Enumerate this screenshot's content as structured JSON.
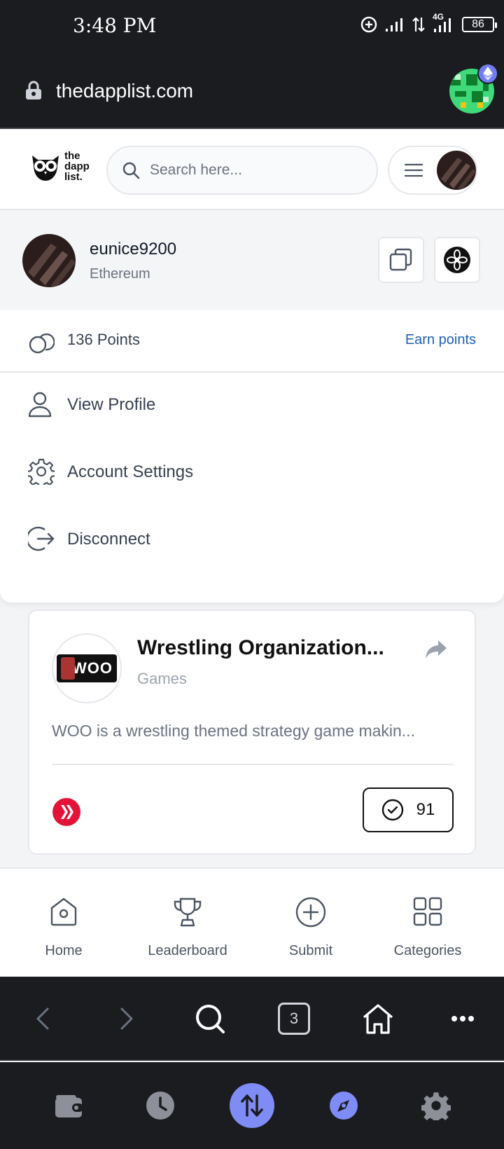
{
  "status_bar": {
    "time": "3:48 PM",
    "network": "4G",
    "battery": "86"
  },
  "browser": {
    "url": "thedapplist.com",
    "tab_count": "3"
  },
  "header": {
    "logo_lines": [
      "the",
      "dapp",
      "list."
    ],
    "search_placeholder": "Search here..."
  },
  "account": {
    "username": "eunice9200",
    "chain": "Ethereum",
    "points": "136 Points",
    "earn_label": "Earn points"
  },
  "menu": {
    "items": [
      {
        "label": "View Profile",
        "icon": "user-icon"
      },
      {
        "label": "Account Settings",
        "icon": "gear-icon"
      },
      {
        "label": "Disconnect",
        "icon": "logout-icon"
      }
    ]
  },
  "card": {
    "logo_text": "WOO",
    "title": "Wrestling Organization...",
    "category": "Games",
    "description": "WOO is a wrestling themed strategy game makin...",
    "votes": "91",
    "chain_icon": "hive-icon"
  },
  "site_nav": {
    "items": [
      {
        "label": "Home",
        "icon": "home-icon"
      },
      {
        "label": "Leaderboard",
        "icon": "trophy-icon"
      },
      {
        "label": "Submit",
        "icon": "plus-circle-icon"
      },
      {
        "label": "Categories",
        "icon": "grid-icon"
      }
    ]
  },
  "colors": {
    "dark_bar": "#1b1c20",
    "link_blue": "#1d5fb3",
    "accent_purple": "#7f8cf5",
    "hive_red": "#e31337"
  }
}
